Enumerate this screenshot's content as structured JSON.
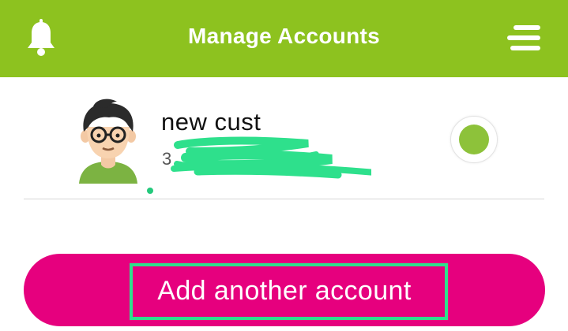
{
  "header": {
    "title": "Manage Accounts",
    "background_color": "#8dc21f",
    "left_icon": "bell-icon",
    "right_icon": "hamburger-menu-icon"
  },
  "account": {
    "name": "new cust",
    "number_visible": "3",
    "number_redacted": true,
    "avatar": "male-user-avatar-with-glasses",
    "selected": true,
    "selected_color": "#8dc23a",
    "status_dot_color": "#24c97c"
  },
  "add_account_button": {
    "label": "Add another account",
    "background_color": "#e6007e",
    "highlight_color": "#2ee08c"
  }
}
